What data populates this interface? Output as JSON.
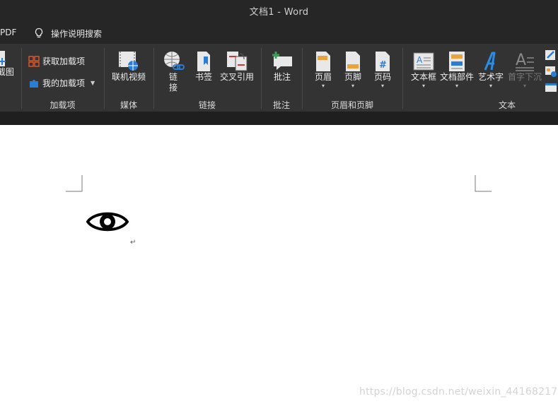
{
  "window": {
    "title": "文档1  -  Word"
  },
  "tabs": {
    "pdf": "PDF",
    "tell_me": "操作说明搜索"
  },
  "ribbon": {
    "screenshot_partial": "截图",
    "addins": {
      "get": "获取加载项",
      "mine": "我的加载项",
      "group": "加载项"
    },
    "media": {
      "online_video": "联机视频",
      "group": "媒体"
    },
    "links": {
      "link_1": "链",
      "link_2": "接",
      "bookmark": "书签",
      "cross_ref": "交叉引用",
      "group": "链接"
    },
    "comments": {
      "comment": "批注",
      "group": "批注"
    },
    "header_footer": {
      "header": "页眉",
      "footer": "页脚",
      "page_number": "页码",
      "group": "页眉和页脚"
    },
    "text": {
      "textbox": "文本框",
      "quick_parts": "文档部件",
      "wordart": "艺术字",
      "dropcap": "首字下沉",
      "group": "文本"
    }
  },
  "document": {
    "paragraph_mark": "↵"
  },
  "watermark": "https://blog.csdn.net/weixin_44168217",
  "colors": {
    "ribbon_bg": "#333333",
    "title_bg": "#262626",
    "accent_blue": "#2b7cd3"
  }
}
